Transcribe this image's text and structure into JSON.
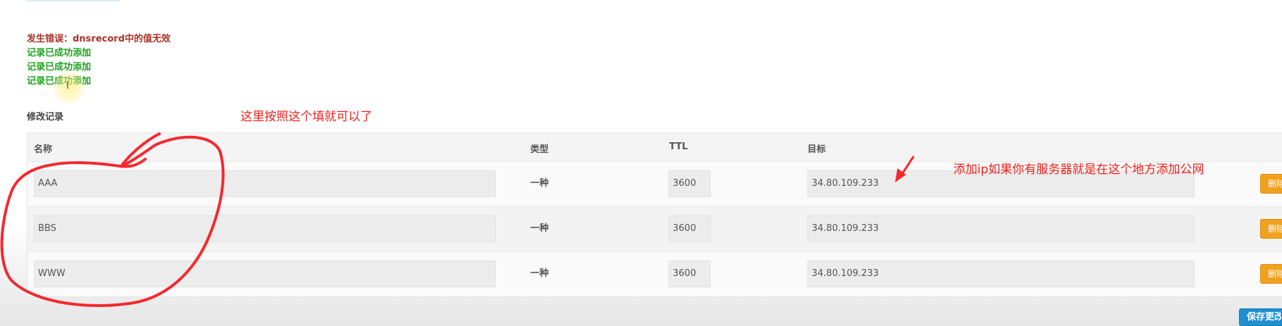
{
  "messages": {
    "error": "发生错误：dnsrecord中的值无效",
    "success": [
      "记录已成功添加",
      "记录已成功添加",
      "记录已成功添加"
    ]
  },
  "section_title": "修改记录",
  "table": {
    "columns": {
      "name": "名称",
      "type": "类型",
      "ttl": "TTL",
      "target": "目标"
    },
    "rows": [
      {
        "name": "AAA",
        "type": "一种",
        "ttl": "3600",
        "target": "34.80.109.233",
        "delete_label": "删除"
      },
      {
        "name": "BBS",
        "type": "一种",
        "ttl": "3600",
        "target": "34.80.109.233",
        "delete_label": "删除"
      },
      {
        "name": "WWW",
        "type": "一种",
        "ttl": "3600",
        "target": "34.80.109.233",
        "delete_label": "删除"
      }
    ]
  },
  "save_label": "保存更改",
  "annotations": {
    "fill_hint": "这里按照这个填就可以了",
    "ip_hint": "添加ip如果你有服务器就是在这个地方添加公网"
  },
  "colors": {
    "error": "#a83226",
    "success": "#1ca41c",
    "annotation": "#f0201a",
    "delete_button": "#f0a11e",
    "save_button": "#1e8fd2"
  },
  "icons": {
    "cursor": "text-cursor-icon"
  }
}
